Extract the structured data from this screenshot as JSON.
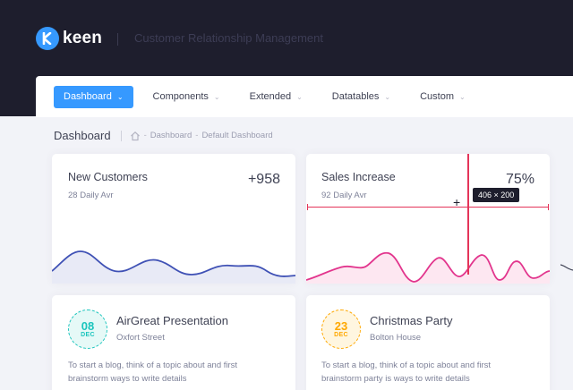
{
  "header": {
    "logo_text": "keen",
    "app_title": "Customer Relationship Management"
  },
  "nav": {
    "items": [
      {
        "label": "Dashboard",
        "active": true
      },
      {
        "label": "Components",
        "active": false
      },
      {
        "label": "Extended",
        "active": false
      },
      {
        "label": "Datatables",
        "active": false
      },
      {
        "label": "Custom",
        "active": false
      }
    ]
  },
  "subheader": {
    "title": "Dashboard",
    "crumbs": [
      "Dashboard",
      "Default Dashboard"
    ]
  },
  "stats": [
    {
      "title": "New Customers",
      "desc": "28 Daily Avr",
      "value": "+958",
      "color": "#3f51b5",
      "fill": "#e8eaf6"
    },
    {
      "title": "Sales Increase",
      "desc": "92 Daily Avr",
      "value": "75%",
      "color": "#e2358d",
      "fill": "#fde7f1"
    }
  ],
  "overlay": {
    "size_label": "406 × 200",
    "guide_color": "#e4345a"
  },
  "events": [
    {
      "day": "08",
      "month": "DEC",
      "title": "AirGreat Presentation",
      "place": "Oxfort Street",
      "text": "To start a blog, think of a topic about and first brainstorm ways to write details",
      "color": "#1bc5bd",
      "bg": "#e6f9f7"
    },
    {
      "day": "23",
      "month": "DEC",
      "title": "Christmas Party",
      "place": "Bolton House",
      "text": "To start a blog, think of a topic about and first brainstorm party is ways to write details",
      "color": "#ffa800",
      "bg": "#fff6e0"
    }
  ],
  "icons": {
    "logo": "keen-logo-icon",
    "caret": "chevron-down-icon",
    "home": "home-icon",
    "crosshair": "crosshair-icon"
  }
}
